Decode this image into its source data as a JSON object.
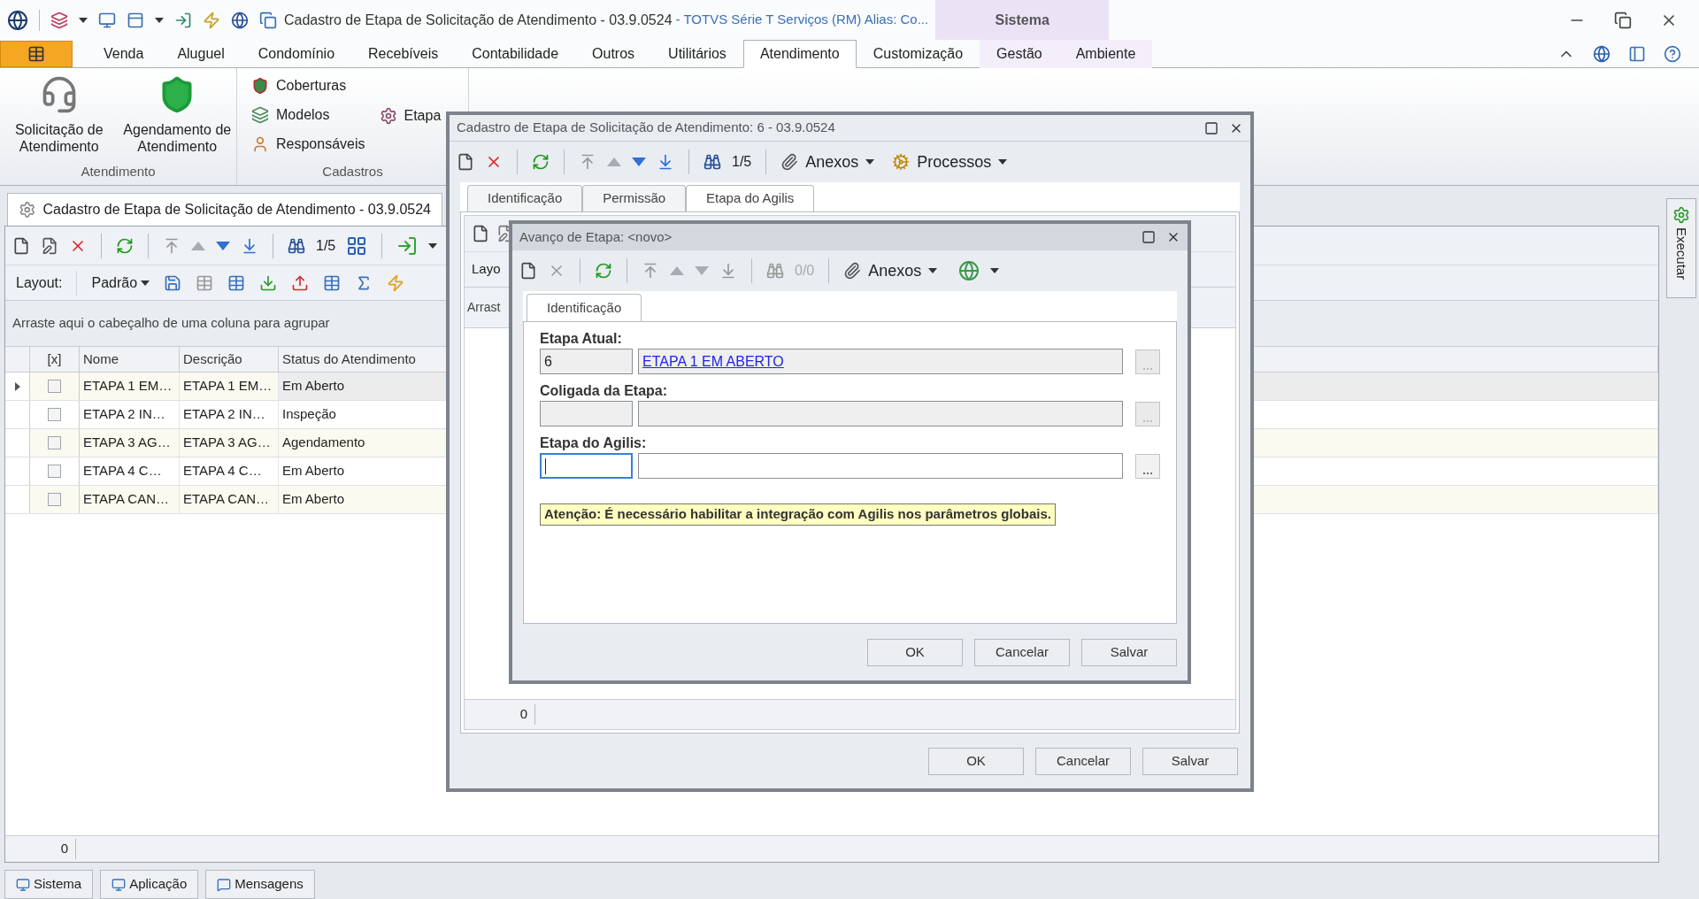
{
  "window": {
    "title": "Cadastro de Etapa de Solicitação de Atendimento - 03.9.0524",
    "subtitle": "- TOTVS Série T Serviços (RM) Alias: Co...",
    "context_tab": "Sistema"
  },
  "menu_tabs": [
    {
      "label": "Venda",
      "selected": false
    },
    {
      "label": "Aluguel",
      "selected": false
    },
    {
      "label": "Condomínio",
      "selected": false
    },
    {
      "label": "Recebíveis",
      "selected": false
    },
    {
      "label": "Contabilidade",
      "selected": false
    },
    {
      "label": "Outros",
      "selected": false
    },
    {
      "label": "Utilitários",
      "selected": false
    },
    {
      "label": "Atendimento",
      "selected": true
    },
    {
      "label": "Customização",
      "selected": false
    },
    {
      "label": "Gestão",
      "selected": false
    },
    {
      "label": "Ambiente",
      "selected": false
    }
  ],
  "ribbon": {
    "groups": [
      {
        "label": "Atendimento",
        "buttons": [
          "Solicitação de Atendimento",
          "Agendamento de Atendimento"
        ]
      },
      {
        "label": "Cadastros",
        "items": [
          "Coberturas",
          "Modelos",
          "Responsáveis"
        ],
        "side_item": "Etapa"
      }
    ]
  },
  "document": {
    "tab_title": "Cadastro de Etapa de Solicitação de Atendimento - 03.9.0524",
    "toolbar": {
      "position": "1/5",
      "enabled": true
    },
    "layout_label": "Layout:",
    "layout_value": "Padrão",
    "group_hint": "Arraste aqui o cabeçalho de uma coluna para agrupar",
    "checkbox_header": "[x]",
    "columns": [
      "Nome",
      "Descrição",
      "Status do Atendimento"
    ],
    "rows": [
      {
        "current": true,
        "checked": false,
        "cells": [
          "ETAPA 1 EM…",
          "ETAPA 1 EM…",
          "Em Aberto"
        ]
      },
      {
        "current": false,
        "checked": false,
        "cells": [
          "ETAPA 2 IN…",
          "ETAPA 2 IN…",
          "Inspeção"
        ]
      },
      {
        "current": false,
        "checked": false,
        "cells": [
          "ETAPA 3 AG…",
          "ETAPA 3 AG…",
          "Agendamento"
        ]
      },
      {
        "current": false,
        "checked": false,
        "cells": [
          "ETAPA 4 C…",
          "ETAPA 4 C…",
          "Em Aberto"
        ]
      },
      {
        "current": false,
        "checked": false,
        "cells": [
          "ETAPA CAN…",
          "ETAPA CAN…",
          "Em Aberto"
        ]
      }
    ],
    "record_count": "0"
  },
  "side_tab": "Executar",
  "bottom_tabs": [
    "Sistema",
    "Aplicação",
    "Mensagens"
  ],
  "outer_dialog": {
    "title": "Cadastro de Etapa de Solicitação de Atendimento: 6 - 03.9.0524",
    "toolbar": {
      "position": "1/5",
      "attachments": "Anexos",
      "processes": "Processos",
      "enabled": true
    },
    "tabs": [
      {
        "label": "Identificação",
        "selected": false
      },
      {
        "label": "Permissão",
        "selected": false
      },
      {
        "label": "Etapa do Agilis",
        "selected": true
      }
    ],
    "layout_label": "Layo",
    "group_hint": "Arrast",
    "record_count": "0",
    "buttons": [
      "OK",
      "Cancelar",
      "Salvar"
    ]
  },
  "inner_dialog": {
    "title": "Avanço de Etapa: <novo>",
    "toolbar": {
      "position": "0/0",
      "attachments": "Anexos",
      "enabled": false
    },
    "tabs": [
      {
        "label": "Identificação",
        "selected": true
      }
    ],
    "fields": [
      {
        "label": "Etapa Atual:",
        "code": "6",
        "description": "ETAPA 1 EM ABERTO",
        "kind": "link",
        "disabled": true,
        "focused": false
      },
      {
        "label": "Coligada da Etapa:",
        "disabled": true,
        "focused": false
      },
      {
        "label": "Etapa do Agilis:",
        "disabled": false,
        "focused": true
      }
    ],
    "warning": "Atenção: É necessário habilitar a integração com Agilis nos parâmetros globais.",
    "buttons": [
      "OK",
      "Cancelar",
      "Salvar"
    ]
  }
}
